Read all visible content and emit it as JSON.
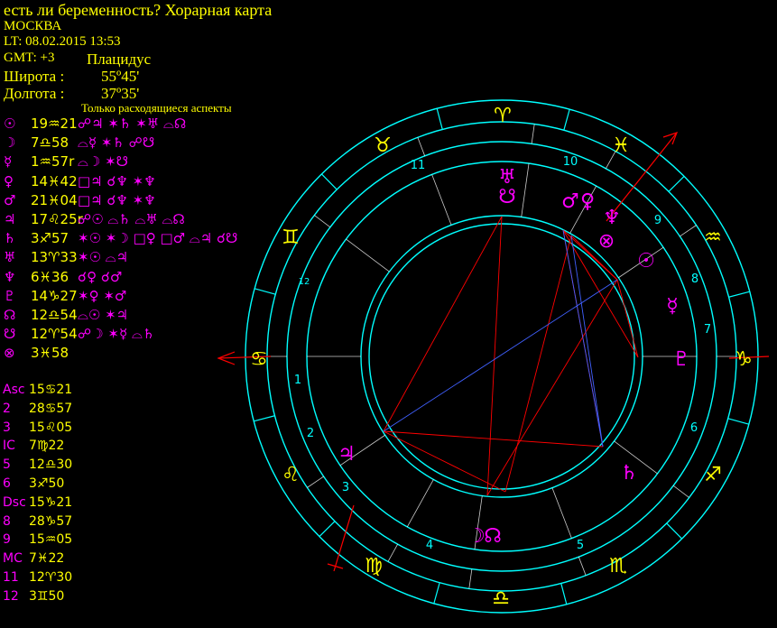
{
  "header": {
    "title": "есть ли беременность? Хорарная карта",
    "city": "МОСКВА",
    "lt": "LT: 08.02.2015  13:53",
    "gmt": "GMT: +3",
    "house_system": "Плацидус",
    "lat_label": "Широта :",
    "lat_value": "55º45'",
    "lon_label": "Долгота :",
    "lon_value": "37º35'",
    "note": "Только расходящиеся аспекты"
  },
  "planets": [
    {
      "symbol": "☉",
      "position": "19♒21",
      "aspects": "☍♃ ✶♄ ✶♅ ⌓☊"
    },
    {
      "symbol": "☽",
      "position": "7♎58",
      "aspects": "⌓☿ ✶♄ ☍☋"
    },
    {
      "symbol": "☿",
      "position": "1♒57r",
      "aspects": "⌓☽ ✶☋"
    },
    {
      "symbol": "♀",
      "position": "14♓42",
      "aspects": "□♃ ☌♆ ✶♆"
    },
    {
      "symbol": "♂",
      "position": "21♓04",
      "aspects": "□♃ ☌♆ ✶♆"
    },
    {
      "symbol": "♃",
      "position": "17♌25r",
      "aspects": "☍☉ ⌓♄ ⌓♅ ⌓☊"
    },
    {
      "symbol": "♄",
      "position": "3♐57",
      "aspects": "✶☉ ✶☽ □♀ □♂ ⌓♃ ☌☋"
    },
    {
      "symbol": "♅",
      "position": "13♈33",
      "aspects": "✶☉ ⌓♃"
    },
    {
      "symbol": "♆",
      "position": "6♓36",
      "aspects": "☌♀ ☌♂"
    },
    {
      "symbol": "♇",
      "position": "14♑27",
      "aspects": "✶♀ ✶♂"
    },
    {
      "symbol": "☊",
      "position": "12♎54",
      "aspects": "⌓☉ ✶♃"
    },
    {
      "symbol": "☋",
      "position": "12♈54",
      "aspects": "☍☽ ✶☿ ⌓♄"
    },
    {
      "symbol": "⊗",
      "position": "3♓58",
      "aspects": ""
    }
  ],
  "cusps": [
    {
      "label": "Asc",
      "value": "15♋21"
    },
    {
      "label": "2",
      "value": "28♋57"
    },
    {
      "label": "3",
      "value": "15♌05"
    },
    {
      "label": "IC",
      "value": "7♍22"
    },
    {
      "label": "5",
      "value": "12♎30"
    },
    {
      "label": "6",
      "value": "3♐50"
    },
    {
      "label": "Dsc",
      "value": "15♑21"
    },
    {
      "label": "8",
      "value": "28♑57"
    },
    {
      "label": "9",
      "value": "15♒05"
    },
    {
      "label": "MC",
      "value": "7♓22"
    },
    {
      "label": "11",
      "value": "12♈30"
    },
    {
      "label": "12",
      "value": "3♊50"
    }
  ],
  "wheel": {
    "signs": [
      "♈",
      "♉",
      "♊",
      "♋",
      "♌",
      "♍",
      "♎",
      "♏",
      "♐",
      "♑",
      "♒",
      "♓"
    ],
    "house_numbers": [
      "1",
      "2",
      "3",
      "4",
      "5",
      "6",
      "7",
      "8",
      "9",
      "10",
      "11",
      "12"
    ],
    "chart_planets": [
      {
        "glyph": "♅",
        "color": "#ff00ff"
      },
      {
        "glyph": "☋",
        "color": "#ff00ff"
      },
      {
        "glyph": "♂",
        "color": "#ff00ff"
      },
      {
        "glyph": "♀",
        "color": "#ff00ff"
      },
      {
        "glyph": "♆",
        "color": "#ff00ff"
      },
      {
        "glyph": "⊗",
        "color": "#ff00ff"
      },
      {
        "glyph": "☉",
        "color": "#ff00ff"
      },
      {
        "glyph": "☿",
        "color": "#ff00ff"
      },
      {
        "glyph": "♇",
        "color": "#ff00ff"
      },
      {
        "glyph": "♄",
        "color": "#ff00ff"
      },
      {
        "glyph": "☽",
        "color": "#ff00ff"
      },
      {
        "glyph": "☊",
        "color": "#ff00ff"
      },
      {
        "glyph": "♃",
        "color": "#ff00ff"
      }
    ],
    "colors": {
      "ring": "#00ffff",
      "sign": "#ffff00",
      "planet": "#ff00ff",
      "house": "#00ffff",
      "aspect_red": "#ff0000",
      "aspect_blue": "#4060ff",
      "axis": "#ff0000"
    }
  }
}
